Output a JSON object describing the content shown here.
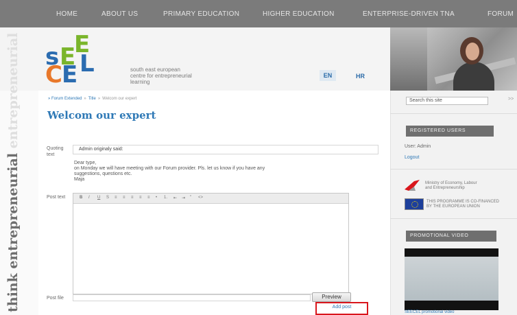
{
  "nav": {
    "items": [
      "HOME",
      "ABOUT US",
      "PRIMARY EDUCATION",
      "HIGHER EDUCATION",
      "ENTERPRISE-DRIVEN TNA",
      "FORUM"
    ]
  },
  "header": {
    "logo_text": "SEECEL",
    "tagline": [
      "south east european",
      "centre for entrepreneurial",
      "learning"
    ],
    "languages": [
      "EN",
      "HR"
    ]
  },
  "vertical_strip": {
    "text_dark": "think entrepreneurial",
    "text_light": " entrepreneurial"
  },
  "breadcrumb": {
    "items": [
      "» Forum Extended",
      "Title"
    ],
    "current": "Welcom our expert"
  },
  "page": {
    "title": "Welcom our expert"
  },
  "form": {
    "quoting_label": "Quoting text",
    "quoting_value": "Admin originaly said:",
    "quote_body": [
      "Dear type,",
      "on Monday we will have meeting with our Forum provider. Pls. let us know if you have any",
      "suggestions, questions etc.",
      "Maja"
    ],
    "post_text_label": "Post text",
    "toolbar_buttons": [
      "B",
      "I",
      "U",
      "S",
      "≡",
      "≡",
      "≡",
      "≡",
      "≡",
      "•",
      "1.",
      "⇤",
      "⇥",
      "\"",
      "<>"
    ],
    "post_file_label": "Post file",
    "preview_label": "Preview",
    "add_post_label": "Add post"
  },
  "sidebar": {
    "search_placeholder": "Search this site",
    "search_go": ">>",
    "registered_users_heading": "REGISTERED USERS",
    "user_line": "User: Admin",
    "logout_label": "Logout",
    "ministry_text": [
      "Ministry of Economy, Labour",
      "and Entrepreneurship"
    ],
    "eu_text": [
      "THIS PROGRAMME IS CO-FINANCED",
      "BY THE EUROPEAN UNION"
    ],
    "promo_heading": "PROMOTIONAL VIDEO",
    "video_caption": "SEECEL promotional video"
  },
  "colors": {
    "nav_bg": "#7b7b7b",
    "link": "#2f79b6",
    "highlight_box": "#d9161c",
    "logo_green": "#7ab52b",
    "logo_blue": "#2b6cb0",
    "logo_orange": "#e8782a"
  }
}
